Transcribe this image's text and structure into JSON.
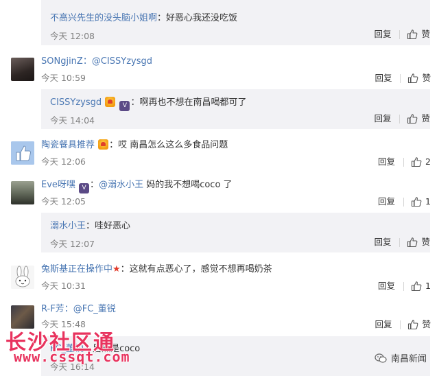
{
  "comments": [
    {
      "sub": true,
      "name": "不高兴先生的没头脑小姐啊",
      "text": "：好恶心我还没吃饭",
      "time": "今天 12:08",
      "reply": "回复",
      "like": "赞"
    },
    {
      "name": "SONgjinZ",
      "text": "：@CISSYzysgd",
      "time": "今天 10:59",
      "reply": "回复",
      "like": "赞"
    },
    {
      "sub": true,
      "name": "CISSYzysgd",
      "text": "：啊再也不想在南昌喝都可了",
      "time": "今天 14:04",
      "reply": "回复",
      "like": "赞"
    },
    {
      "name": "陶瓷餐具推荐",
      "text": "：哎 南昌怎么这么多食品问题",
      "time": "今天 12:06",
      "reply": "回复",
      "like": "2"
    },
    {
      "name": "Eve呀嘿",
      "text_pre": "：",
      "mention": "@溺水小王",
      "text": " 妈的我不想喝coco 了",
      "time": "今天 12:05",
      "reply": "回复",
      "like": "1"
    },
    {
      "sub": true,
      "name": "溺水小王",
      "text": "：哇好恶心",
      "time": "今天 12:07",
      "reply": "回复",
      "like": "赞"
    },
    {
      "name": "兔斯基正在操作中",
      "text": "：这就有点恶心了，感觉不想再喝奶茶",
      "time": "今天 10:31",
      "reply": "回复",
      "like": "1"
    },
    {
      "name": "R-F芳",
      "text": "：@FC_董锐",
      "time": "今天 15:48",
      "reply": "回复",
      "like": "赞"
    },
    {
      "sub": true,
      "name": "FC_董锐",
      "text": "：居然是coco",
      "time": "今天 16:14",
      "reply": "回复",
      "like": "赞"
    }
  ],
  "watermark": {
    "logo": "长沙社区通",
    "url": "www.cssqt.com",
    "source": "南昌新闻"
  },
  "colors": {
    "link": "#4a77b3",
    "time": "#808080",
    "sub_bg": "#f2f2f5",
    "watermark": "#e8335e"
  }
}
